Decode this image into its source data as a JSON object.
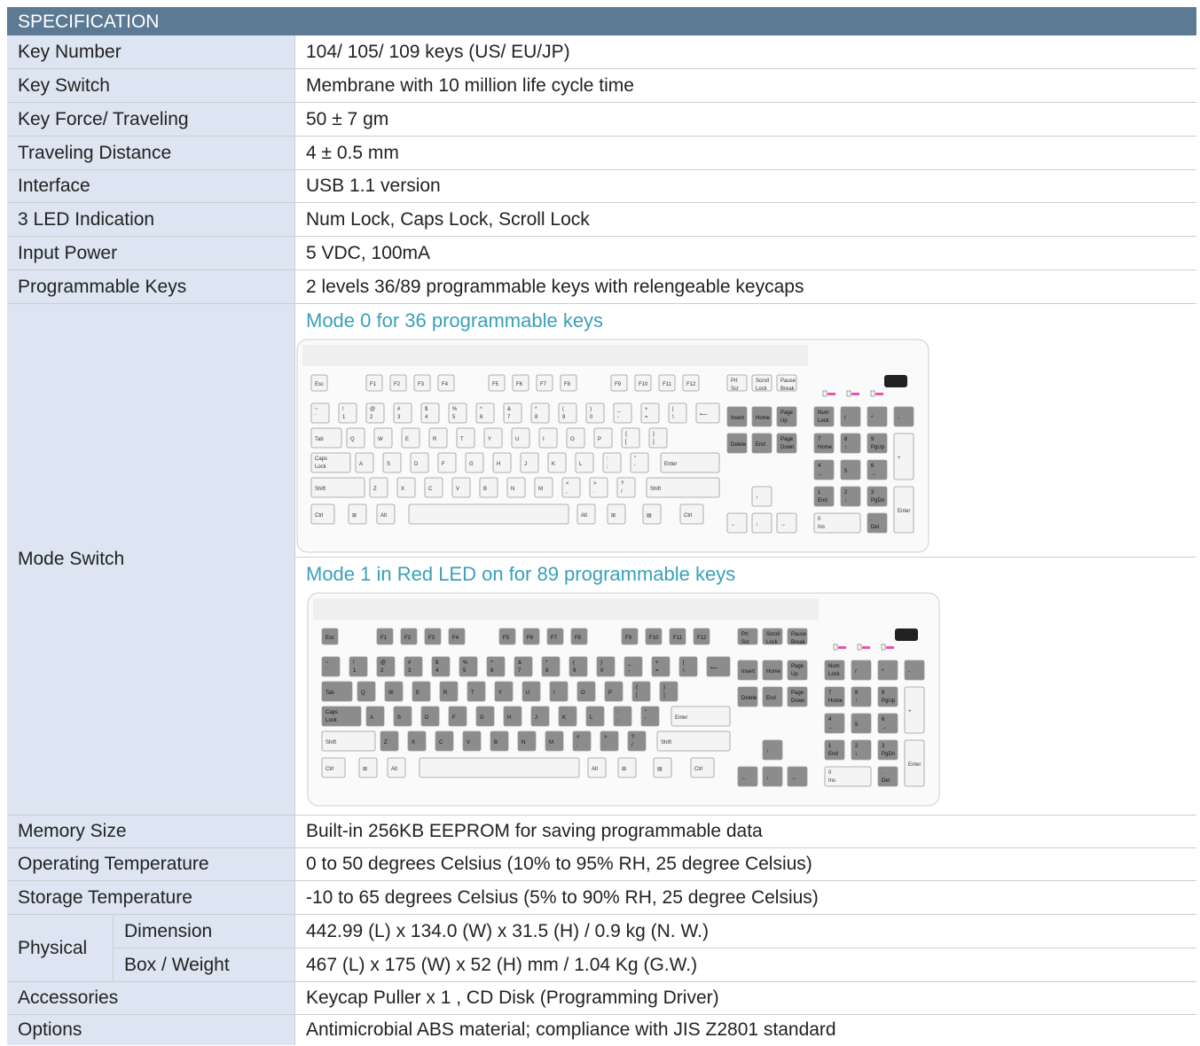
{
  "title": "SPECIFICATION",
  "rows_top": [
    {
      "label": "Key Number",
      "value": "104/ 105/ 109 keys (US/ EU/JP)"
    },
    {
      "label": "Key Switch",
      "value": "Membrane with 10 million life cycle time"
    },
    {
      "label": "Key Force/ Traveling",
      "value": "50 ± 7 gm"
    },
    {
      "label": "Traveling Distance",
      "value": "4 ± 0.5 mm"
    },
    {
      "label": "Interface",
      "value": "USB 1.1 version"
    },
    {
      "label": "3 LED Indication",
      "value": "Num Lock, Caps Lock, Scroll Lock"
    },
    {
      "label": "Input Power",
      "value": "5 VDC, 100mA"
    },
    {
      "label": "Programmable Keys",
      "value": "2 levels 36/89 programmable keys with relengeable keycaps"
    }
  ],
  "mode_switch": {
    "label": "Mode Switch",
    "mode0": "Mode 0 for 36 programmable keys",
    "mode1": "Mode 1 in Red LED on for 89 programmable keys"
  },
  "rows_mid": [
    {
      "label": "Memory Size",
      "value": "Built-in 256KB EEPROM for saving programmable data"
    },
    {
      "label": "Operating Temperature",
      "value": "0 to 50 degrees Celsius (10% to 95% RH, 25 degree Celsius)"
    },
    {
      "label": "Storage Temperature",
      "value": "-10 to 65 degrees Celsius (5% to 90% RH, 25 degree Celsius)"
    }
  ],
  "physical": {
    "label": "Physical",
    "dimension_label": "Dimension",
    "dimension_value": "442.99 (L) x 134.0 (W) x 31.5 (H) / 0.9 kg (N. W.)",
    "box_label": "Box / Weight",
    "box_value": "467 (L) x 175 (W) x 52 (H) mm / 1.04 Kg (G.W.)"
  },
  "rows_bottom": [
    {
      "label": "Accessories",
      "value": "Keycap Puller x 1 , CD Disk (Programming Driver)"
    },
    {
      "label": "Options",
      "value": "Antimicrobial ABS material; compliance with JIS Z2801 standard"
    }
  ],
  "keyboard": {
    "fn_row": [
      "Esc",
      "F1",
      "F2",
      "F3",
      "F4",
      "F5",
      "F6",
      "F7",
      "F8",
      "F9",
      "F10",
      "F11",
      "F12"
    ],
    "nav_top": [
      "Prt Scr SysRq",
      "Scroll Lock",
      "Pause Break"
    ],
    "row1": [
      "~ `",
      "! 1",
      "@ 2",
      "# 3",
      "$ 4",
      "% 5",
      "^ 6",
      "& 7",
      "* 8",
      "( 9",
      ") 0",
      "_ -",
      "+ =",
      "| \\",
      "⟵"
    ],
    "row2": [
      "Tab",
      "Q",
      "W",
      "E",
      "R",
      "T",
      "Y",
      "U",
      "I",
      "O",
      "P",
      "{ [",
      "} ]"
    ],
    "row3": [
      "Caps Lock",
      "A",
      "S",
      "D",
      "F",
      "G",
      "H",
      "J",
      "K",
      "L",
      ": ;",
      "\" '",
      "Enter"
    ],
    "row4": [
      "Shift",
      "Z",
      "X",
      "C",
      "V",
      "B",
      "N",
      "M",
      "< ,",
      "> .",
      "? /",
      "Shift"
    ],
    "row5": [
      "Ctrl",
      "⊞",
      "Alt",
      "",
      "Alt",
      "⊞",
      "▤",
      "Ctrl"
    ],
    "nav1": [
      "Insert",
      "Home",
      "Page Up"
    ],
    "nav2": [
      "Delete",
      "End",
      "Page Down"
    ],
    "arrows": [
      "↑",
      "←",
      "↓",
      "→"
    ],
    "numpad": [
      "Num Lock",
      "/",
      "*",
      "-",
      "7 Home",
      "8 ↑",
      "9 PgUp",
      "+",
      "4 ←",
      "5",
      "6 →",
      "1 End",
      "2 ↓",
      "3 PgDn",
      "Enter",
      "0 Ins",
      ". Del"
    ]
  }
}
